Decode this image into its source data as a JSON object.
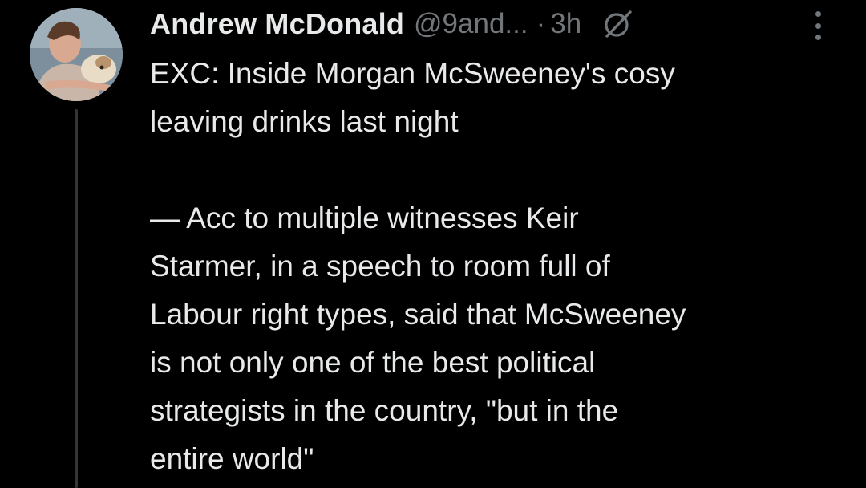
{
  "tweet": {
    "author": {
      "display_name": "Andrew McDonald",
      "handle": "@9and...",
      "avatar_icon": "profile-photo"
    },
    "separator": "·",
    "time": "3h",
    "grok_icon": "grok-slash-icon",
    "more_icon": "more-vertical-icon",
    "text": {
      "paragraph_1": "EXC: Inside Morgan McSweeney's cosy\nleaving drinks last night",
      "paragraph_2": "— Acc to multiple witnesses Keir\nStarmer, in a speech to room full of\nLabour right types, said that McSweeney\nis not only one of the best political\nstrategists in the country, \"but in the\nentire world\""
    }
  },
  "colors": {
    "background": "#000000",
    "primary_text": "#e7e9ea",
    "secondary_text": "#71767b",
    "thread_line": "#333639"
  }
}
